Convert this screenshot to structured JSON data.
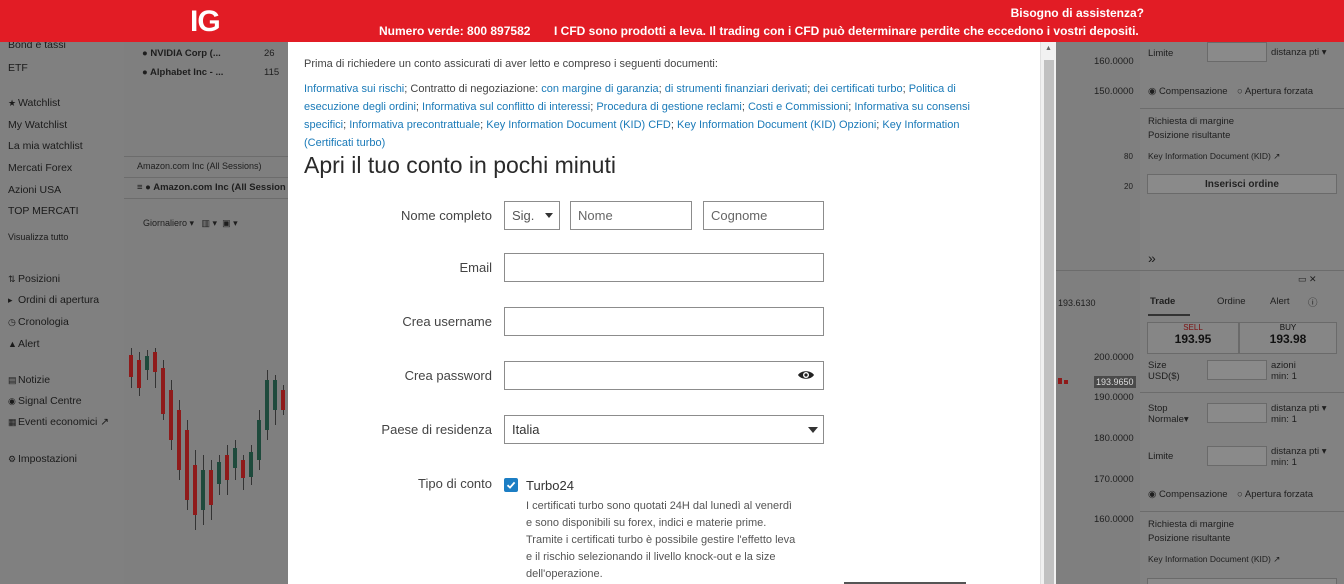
{
  "header": {
    "logo": "IG",
    "assistance": "Bisogno di assistenza?",
    "toll_free": "Numero verde: 800 897582",
    "cfd_warning": "I CFD sono prodotti a leva. Il trading con i CFD può determinare perdite che eccedono i vostri depositi."
  },
  "sidebar": {
    "top_items": [
      "Bond e tassi",
      "ETF"
    ],
    "watch_items": [
      "Watchlist",
      "My Watchlist",
      "La mia watchlist",
      "Mercati Forex",
      "Azioni USA",
      "TOP MERCATI"
    ],
    "view_all": "Visualizza tutto",
    "nav_items": [
      "Posizioni",
      "Ordini di apertura",
      "Cronologia",
      "Alert"
    ],
    "more_items": [
      "Notizie",
      "Signal Centre",
      "Eventi economici"
    ],
    "settings": "Impostazioni"
  },
  "background": {
    "watchlist_rows": [
      {
        "name": "NVIDIA Corp (...",
        "value": "26"
      },
      {
        "name": "Alphabet Inc - ...",
        "value": "115"
      }
    ],
    "chart_tab": "Amazon.com Inc (All Sessions)",
    "chart_title": "Amazon.com Inc (All Session",
    "timeframe": "Giornaliero",
    "axis_prices_top": [
      "160.0000",
      "150.0000"
    ],
    "axis_prices_bottom": [
      "200.0000",
      "190.0000",
      "180.0000",
      "170.0000",
      "160.0000"
    ],
    "price_tag": "193.9650",
    "mini_values": [
      "80",
      "20"
    ],
    "left_price": "193.6130",
    "ticket_top": {
      "limite": "Limite",
      "distanza": "distanza pti",
      "compensazione": "Compensazione",
      "apertura_forzata": "Apertura forzata",
      "richiesta": "Richiesta di margine",
      "posizione": "Posizione risultante",
      "kid": "Key Information Document (KID)",
      "place_order": "Inserisci ordine"
    },
    "ticket": {
      "tabs": [
        "Trade",
        "Ordine",
        "Alert"
      ],
      "sell_label": "SELL",
      "sell_price": "193.95",
      "buy_label": "BUY",
      "buy_price": "193.98",
      "size_label": "Size",
      "size_unit": "USD($)",
      "size_hint": "azioni",
      "size_min": "min: 1",
      "stop_label": "Stop",
      "stop_type": "Normale",
      "distanza": "distanza pti",
      "min": "min: 1",
      "limite": "Limite",
      "compensazione": "Compensazione",
      "apertura_forzata": "Apertura forzata",
      "richiesta": "Richiesta di margine",
      "posizione": "Posizione risultante",
      "kid": "Key Information Document (KID)"
    }
  },
  "modal": {
    "intro": "Prima di richiedere un conto assicurati di aver letto e compreso i seguenti documenti:",
    "docs": {
      "d1": "Informativa sui rischi",
      "t1": "; Contratto di negoziazione: ",
      "d2": "con margine di garanzia",
      "d3": "di strumenti finanziari derivati",
      "d4": "dei certificati turbo",
      "d5": "Politica di esecuzione degli ordini",
      "d6": "Informativa sul conflitto di interessi",
      "d7": "Procedura di gestione reclami",
      "d8": "Costi e Commissioni",
      "d9": "Informativa su consensi specifici",
      "d10": "Informativa precontrattuale",
      "d11": "Key Information Document (KID) CFD",
      "d12": "Key Information Document (KID) Opzioni",
      "d13": "Key Information (Certificati turbo)"
    },
    "title": "Apri il tuo conto in pochi minuti",
    "form": {
      "full_name_label": "Nome completo",
      "salutation": "Sig.",
      "first_name_placeholder": "Nome",
      "last_name_placeholder": "Cognome",
      "email_label": "Email",
      "username_label": "Crea username",
      "password_label": "Crea password",
      "country_label": "Paese di residenza",
      "country_value": "Italia",
      "account_type_label": "Tipo di conto",
      "account_option": "Turbo24",
      "account_description": "I certificati turbo sono quotati 24H dal lunedì al venerdì e sono disponibili su forex, indici e materie prime. Tramite i certificati turbo è possibile gestire l'effetto leva e il rischio selezionando il livello knock-out e la size dell'operazione."
    }
  }
}
